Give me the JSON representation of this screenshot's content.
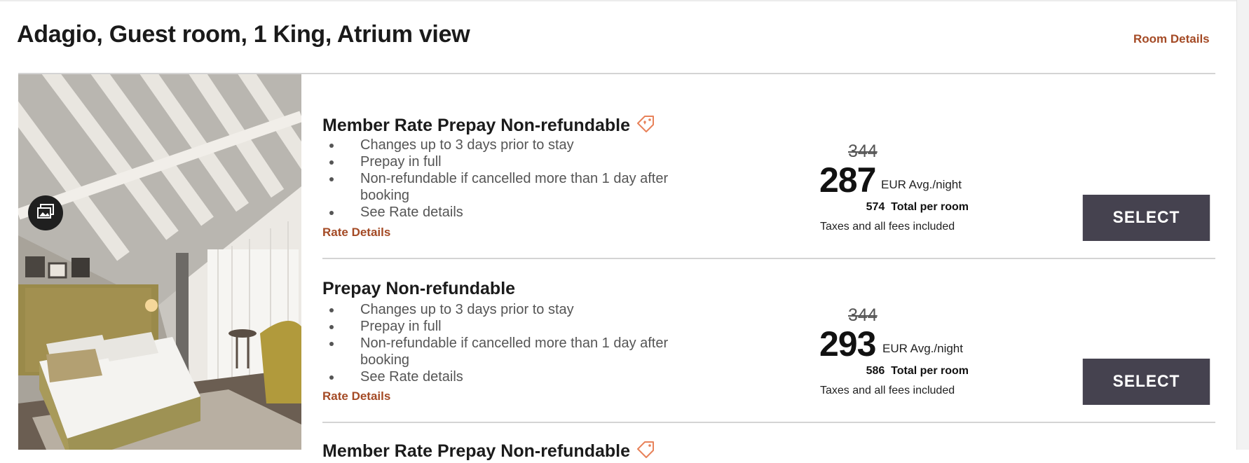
{
  "room": {
    "title": "Adagio, Guest room, 1 King, Atrium view",
    "details_link": "Room Details"
  },
  "colors": {
    "accent": "#a44a25",
    "select_button": "#45424f",
    "divider": "#d4d4d4",
    "tag_icon": "#e8825a"
  },
  "icons": {
    "gallery": "photo-gallery-icon",
    "member_tag": "member-tag-icon"
  },
  "rates": [
    {
      "name": "Member Rate Prepay Non-refundable",
      "member_tag": true,
      "bullets": [
        "Changes up to 3 days prior to stay",
        "Prepay in full",
        "Non-refundable if cancelled more than 1 day after booking",
        "See Rate details"
      ],
      "details_link": "Rate Details",
      "old_price": "344",
      "price": "287",
      "price_unit": "EUR Avg./night",
      "total_value": "574",
      "total_label": "Total per room",
      "taxes": "Taxes and all fees included",
      "select_label": "SELECT"
    },
    {
      "name": "Prepay Non-refundable",
      "member_tag": false,
      "bullets": [
        "Changes up to 3 days prior to stay",
        "Prepay in full",
        "Non-refundable if cancelled more than 1 day after booking",
        "See Rate details"
      ],
      "details_link": "Rate Details",
      "old_price": "344",
      "price": "293",
      "price_unit": "EUR Avg./night",
      "total_value": "586",
      "total_label": "Total per room",
      "taxes": "Taxes and all fees included",
      "select_label": "SELECT"
    },
    {
      "name": "Member Rate Prepay Non-refundable",
      "member_tag": true
    }
  ]
}
